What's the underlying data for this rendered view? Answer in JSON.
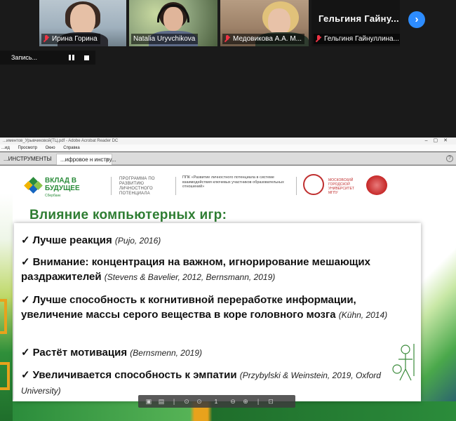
{
  "participants": [
    {
      "name": "Ирина Горина",
      "muted": true
    },
    {
      "name": "Natalia Uryvchikova",
      "muted": false
    },
    {
      "name": "Медовикова А.А. М...",
      "muted": true
    },
    {
      "name": "Гельгиня Гайнуллина...",
      "muted": true,
      "display_name": "Гельгиня  Гайну..."
    }
  ],
  "recording": {
    "label": "Запись..."
  },
  "next_icon": "chevron-right-icon",
  "viewer": {
    "title": "...иментов_Урывчиковой(ТЦ.pdf - Adobe Acrobat Reader DC",
    "menu": [
      "...ид",
      "Просмотр",
      "Окно",
      "Справка"
    ],
    "tabs": [
      "...ИНСТРУМЕНТЫ",
      "...ифровое н инстру..."
    ],
    "help": "?"
  },
  "slide": {
    "logo1": "ВКЛАД В БУДУЩЕЕ",
    "logo1_sub": "Сбербанк",
    "program": "ПРОГРАММА ПО РАЗВИТИЮ ЛИЧНОСТНОГО ПОТЕНЦИАЛА",
    "ppk": "ППК «Развитие личностного потенциала в системе взаимодействия ключевых участников образовательных отношений»",
    "mgpu": "МОСКОВСКИЙ ГОРОДСКОЙ УНИВЕРСИТЕТ МГПУ",
    "title": "Влияние компьютерных игр:",
    "items": [
      {
        "text": "Лучше реакция",
        "cite": "(Pujo, 2016)"
      },
      {
        "text": "Внимание: концентрация на важном, игнорирование мешающих раздражителей",
        "cite": "(Stevens & Bavelier, 2012, Bernsmann, 2019)"
      },
      {
        "text": "Лучше способность к когнитивной переработке информации, увеличение массы серого вещества в коре головного мозга",
        "cite": "(Kühn, 2014)"
      },
      {
        "text": "Растёт мотивация",
        "cite": "(Bernsmenn, 2019)"
      },
      {
        "text": "Увеличивается способность к эмпатии",
        "cite": "(Przybylski & Weinstein, 2019, Oxford University)"
      }
    ]
  },
  "pdf_toolbar": {
    "page": "1"
  },
  "colors": {
    "accent": "#2d8cff",
    "slide_green": "#2e7d32",
    "brand_orange": "#e8a21c"
  }
}
